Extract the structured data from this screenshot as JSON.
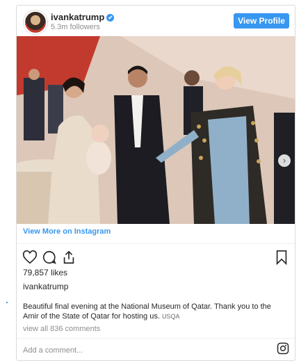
{
  "header": {
    "username": "ivankatrump",
    "verified_glyph": "✔",
    "followers": "5.3m followers",
    "view_profile_label": "View Profile"
  },
  "carousel": {
    "next_glyph": "›",
    "slide_count": 4,
    "active_slide": 1
  },
  "view_more_label": "View More on Instagram",
  "likes": "79,857 likes",
  "caption": {
    "username": "ivankatrump",
    "text": "Beautiful final evening at the National Museum of Qatar. Thank you to the Amir of the State of Qatar for hosting us.",
    "tag": "USQA"
  },
  "comments_link": "view all 836 comments",
  "add_comment_placeholder": "Add a comment...",
  "icons": {
    "like": "heart-icon",
    "comment": "comment-icon",
    "share": "share-icon",
    "save": "bookmark-icon",
    "instagram": "instagram-icon"
  },
  "colors": {
    "accent": "#3897f0",
    "muted": "#8e8e8e",
    "text": "#262626"
  }
}
